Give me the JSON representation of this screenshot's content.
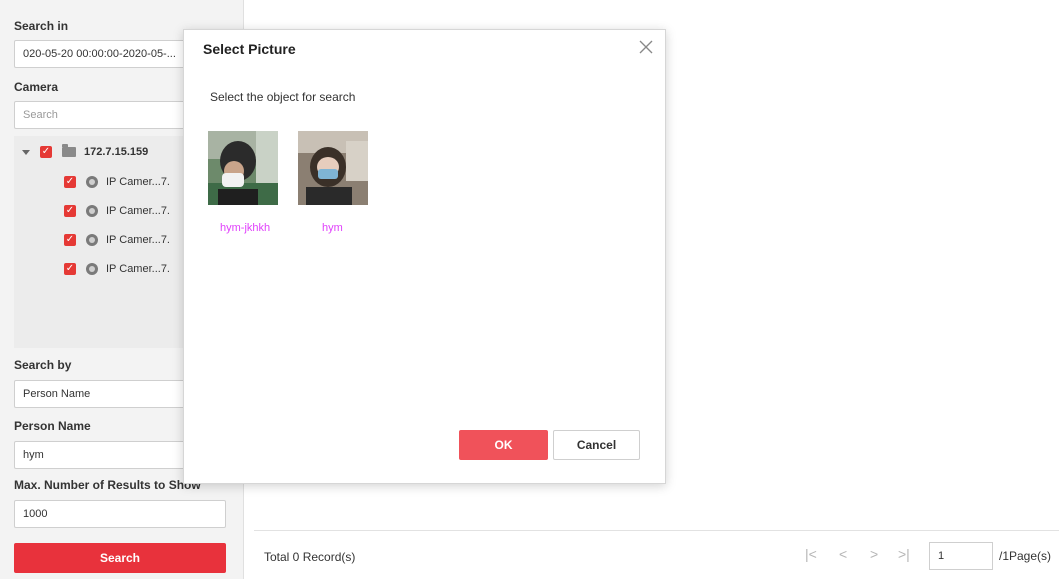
{
  "left_panel": {
    "search_in_label": "Search in",
    "time_range": "020-05-20 00:00:00-2020-05-...",
    "camera_label": "Camera",
    "camera_search_placeholder": "Search",
    "tree": {
      "root": "172.7.15.159",
      "items": [
        "IP Camer...7.",
        "IP Camer...7.",
        "IP Camer...7.",
        "IP Camer...7."
      ]
    },
    "search_by_label": "Search by",
    "search_by_value": "Person Name",
    "person_name_label": "Person Name",
    "person_name_value": "hym",
    "max_results_label": "Max. Number of Results to Show",
    "max_results_value": "1000",
    "search_button": "Search"
  },
  "results": {
    "total_records": "Total 0 Record(s)",
    "page_input": "1",
    "page_total": "/1Page(s)"
  },
  "dialog": {
    "title": "Select Picture",
    "subtitle": "Select the object for search",
    "pictures": [
      {
        "name": "hym-jkhkh"
      },
      {
        "name": "hym"
      }
    ],
    "ok_label": "OK",
    "cancel_label": "Cancel"
  },
  "colors": {
    "accent_red": "#e8323c",
    "name_pink": "#e040fb"
  }
}
